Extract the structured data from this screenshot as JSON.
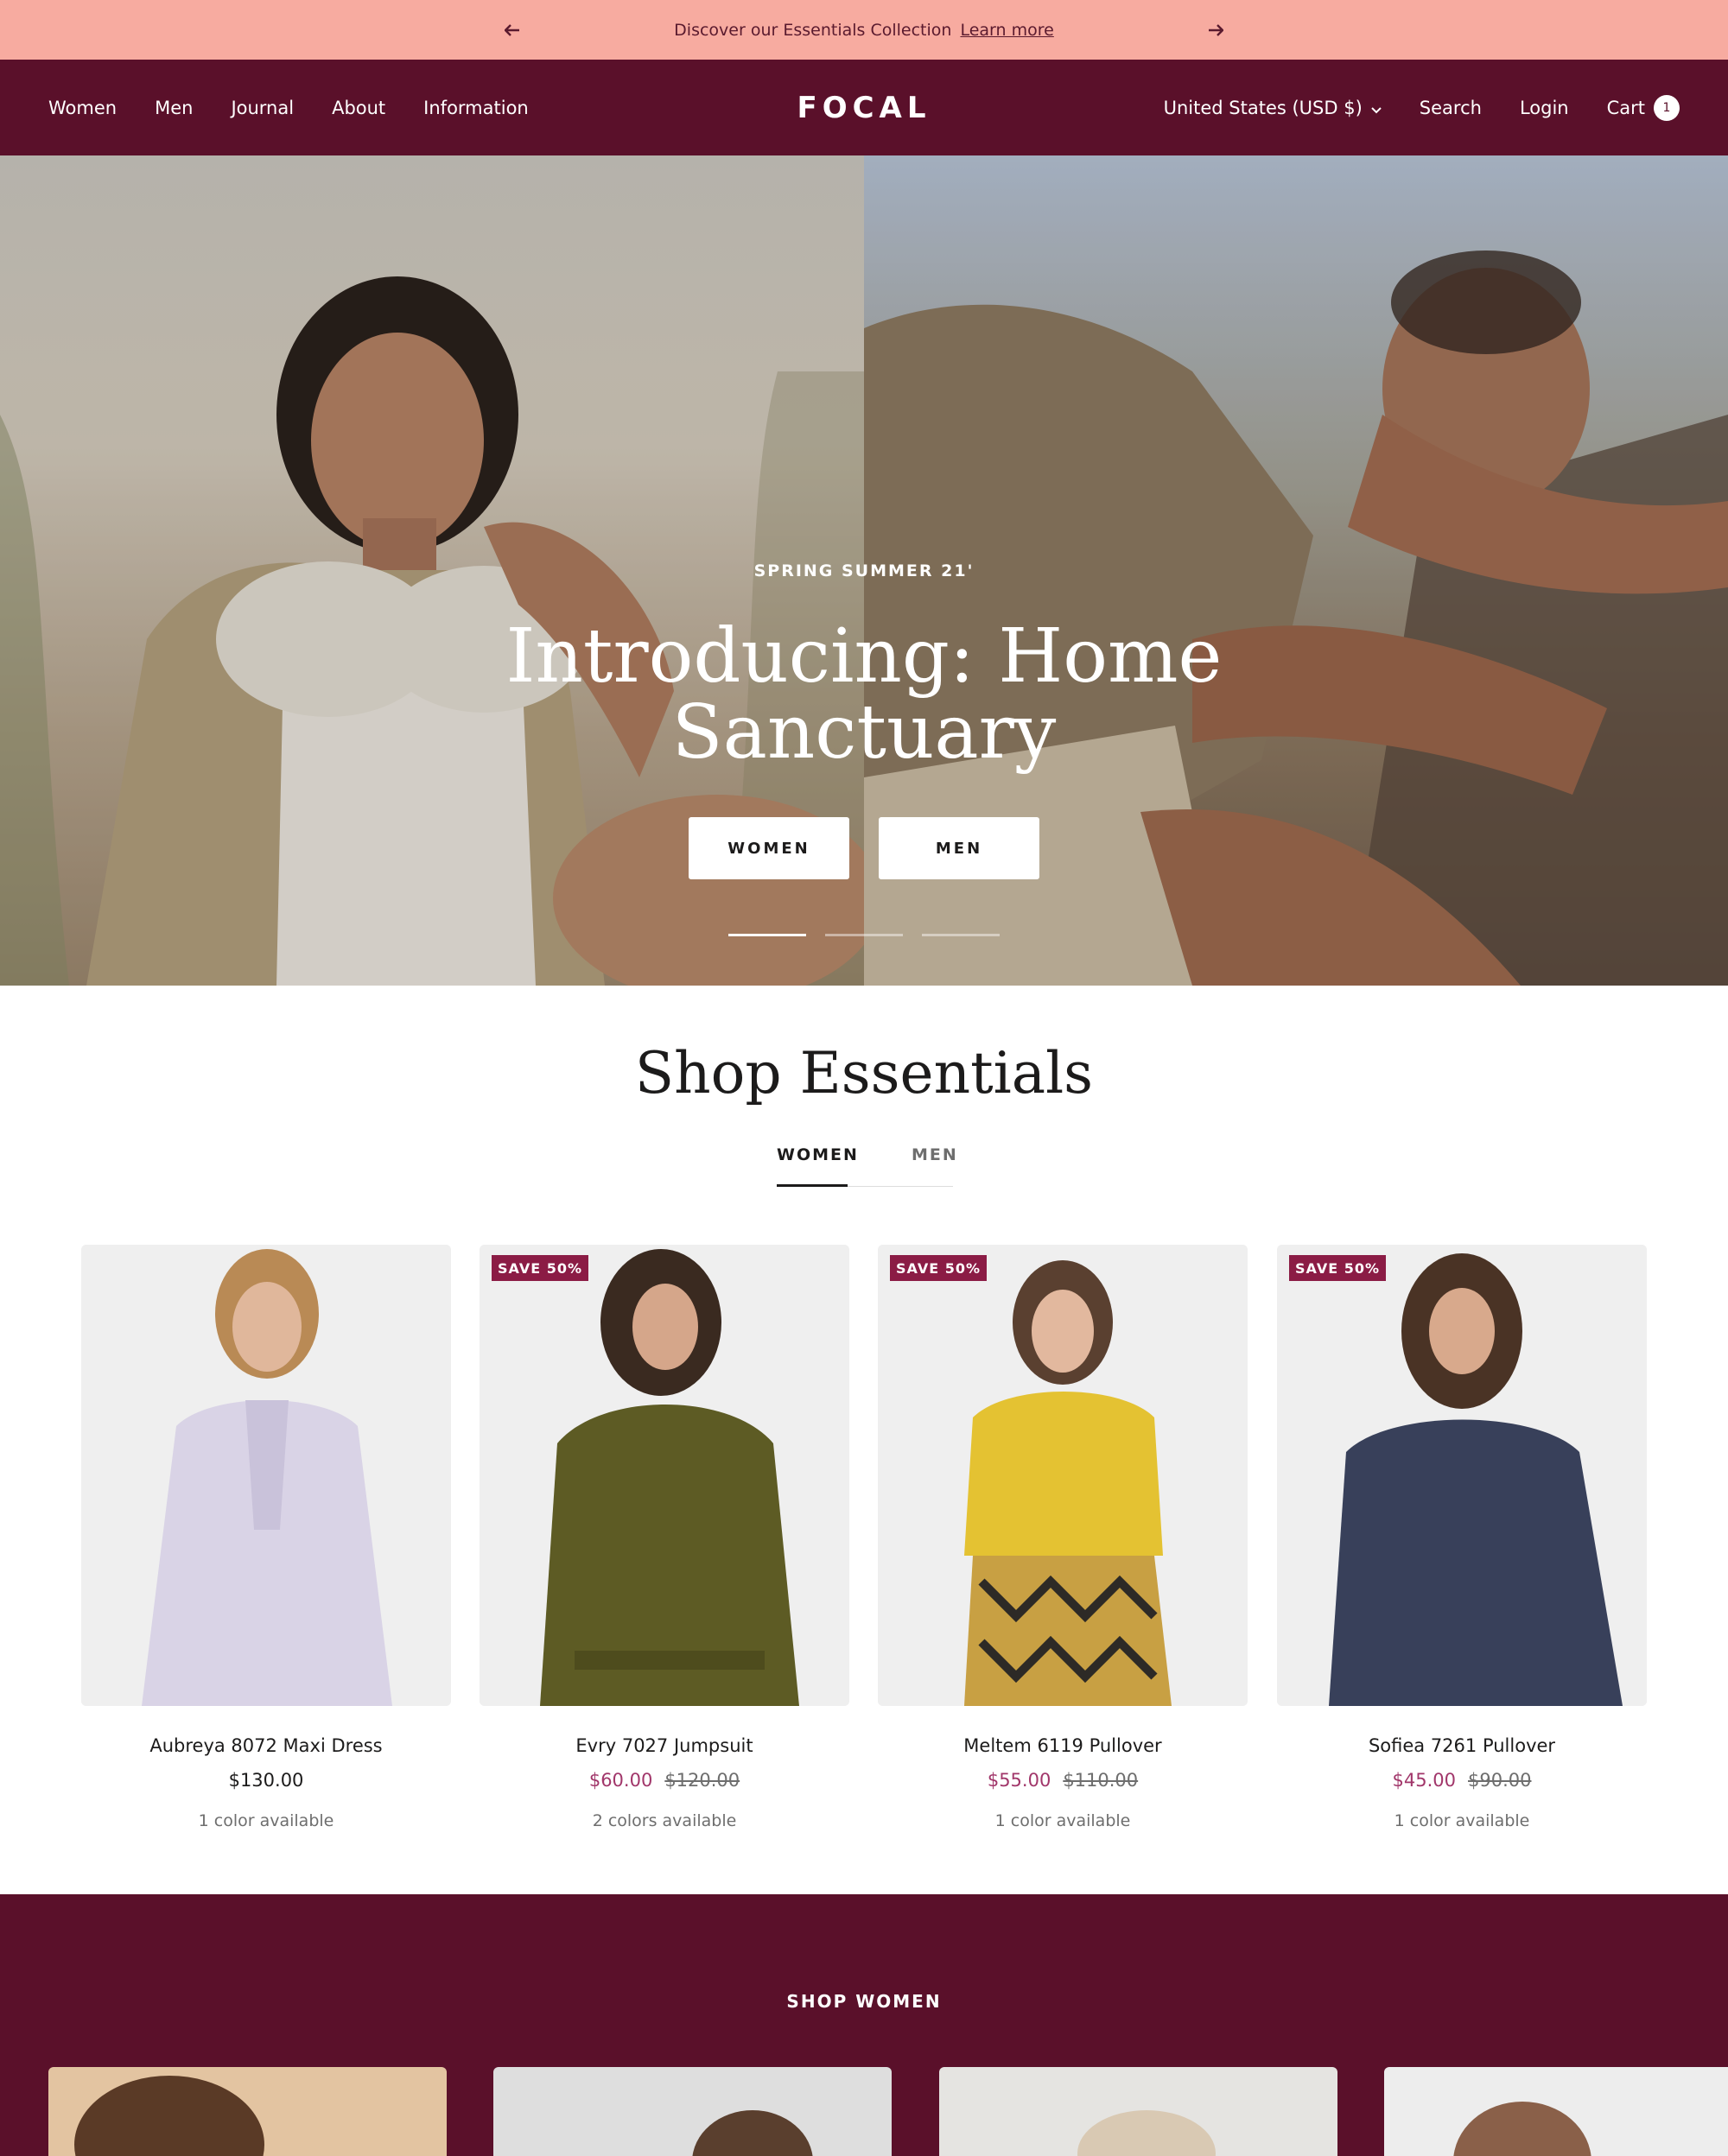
{
  "announcement": {
    "text": "Discover our Essentials Collection",
    "link": "Learn more"
  },
  "header": {
    "nav": [
      "Women",
      "Men",
      "Journal",
      "About",
      "Information"
    ],
    "logo": "FOCAL",
    "currency": "United States (USD $)",
    "search": "Search",
    "login": "Login",
    "cart": "Cart",
    "cart_count": "1"
  },
  "hero": {
    "subtitle": "SPRING SUMMER 21'",
    "title": "Introducing: Home Sanctuary",
    "buttons": [
      "WOMEN",
      "MEN"
    ],
    "slides": 3,
    "active_slide": 1
  },
  "essentials": {
    "title": "Shop Essentials",
    "tabs": [
      "WOMEN",
      "MEN"
    ],
    "active_tab": "WOMEN",
    "products": [
      {
        "name": "Aubreya 8072 Maxi Dress",
        "price": "$130.00",
        "compare": "",
        "badge": "",
        "colors": "1 color available"
      },
      {
        "name": "Evry 7027 Jumpsuit",
        "price": "$60.00",
        "compare": "$120.00",
        "badge": "SAVE 50%",
        "colors": "2 colors available"
      },
      {
        "name": "Meltem 6119 Pullover",
        "price": "$55.00",
        "compare": "$110.00",
        "badge": "SAVE 50%",
        "colors": "1 color available"
      },
      {
        "name": "Sofiea 7261 Pullover",
        "price": "$45.00",
        "compare": "$90.00",
        "badge": "SAVE 50%",
        "colors": "1 color available"
      }
    ]
  },
  "shop_women": {
    "label": "SHOP WOMEN"
  },
  "colors": {
    "announcement_bg": "#f7aba0",
    "header_bg": "#5a102a",
    "badge_bg": "#8b1c45",
    "sale_price": "#a1366a"
  }
}
